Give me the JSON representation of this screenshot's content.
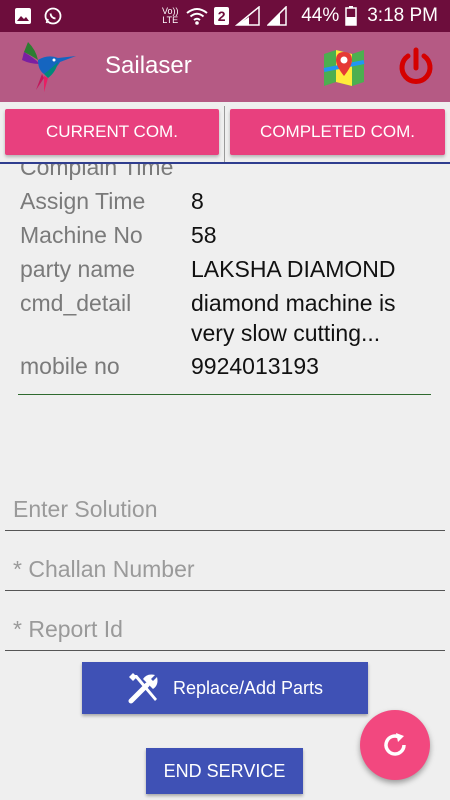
{
  "status_bar": {
    "battery": "44%",
    "time": "3:18 PM",
    "volte_label": "Vo)) LTE",
    "sim_badge": "2"
  },
  "app_bar": {
    "title": "Sailaser",
    "icons": [
      "hummingbird-logo",
      "map-icon",
      "power-icon"
    ]
  },
  "tabs": [
    {
      "label": "CURRENT COM."
    },
    {
      "label": "COMPLETED COM."
    }
  ],
  "details": [
    {
      "label": "Complain Time",
      "value": ""
    },
    {
      "label": "Assign Time",
      "value": "8"
    },
    {
      "label": "Machine No",
      "value": "58"
    },
    {
      "label": "party name",
      "value": "LAKSHA DIAMOND"
    },
    {
      "label": "cmd_detail",
      "value": "diamond machine is very slow cutting..."
    },
    {
      "label": "mobile no",
      "value": "9924013193"
    }
  ],
  "form": {
    "solution_placeholder": "Enter Solution",
    "challan_placeholder": "* Challan Number",
    "report_placeholder": "* Report Id"
  },
  "buttons": {
    "replace_parts": "Replace/Add Parts",
    "end_service": "END SERVICE"
  },
  "colors": {
    "status_bar": "#6d0d3c",
    "app_bar": "#b55a84",
    "tab": "#e8407e",
    "button": "#3f51b5",
    "fab": "#f2487f"
  }
}
